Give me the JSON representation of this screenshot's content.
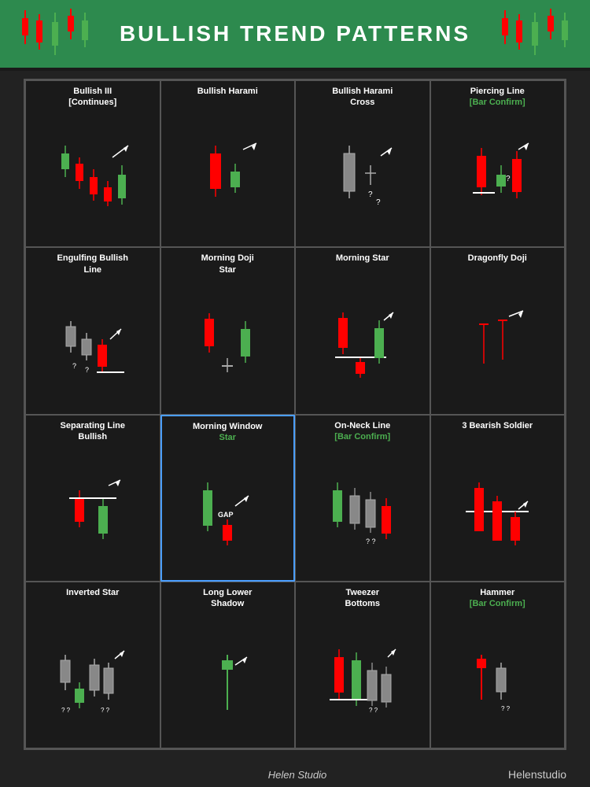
{
  "header": {
    "title": "BULLISH TREND PATTERNS"
  },
  "cells": [
    {
      "id": "bullish-3",
      "title": "Bullish III",
      "subtitle": "[Continues]",
      "subtitle_color": "white"
    },
    {
      "id": "bullish-harami",
      "title": "Bullish Harami",
      "subtitle": "",
      "subtitle_color": "white"
    },
    {
      "id": "bullish-harami-cross",
      "title": "Bullish Harami",
      "subtitle": "Cross",
      "subtitle_color": "white"
    },
    {
      "id": "piercing-line",
      "title": "Piercing Line",
      "subtitle": "[Bar Confirm]",
      "subtitle_color": "green"
    },
    {
      "id": "engulfing-bullish",
      "title": "Engulfing Bullish",
      "subtitle": "Line",
      "subtitle_color": "white"
    },
    {
      "id": "morning-doji-star",
      "title": "Morning Doji",
      "subtitle": "Star",
      "subtitle_color": "white"
    },
    {
      "id": "morning-star",
      "title": "Morning Star",
      "subtitle": "",
      "subtitle_color": "white"
    },
    {
      "id": "dragonfly-doji",
      "title": "Dragonfly Doji",
      "subtitle": "",
      "subtitle_color": "white"
    },
    {
      "id": "separating-line",
      "title": "Separating Line",
      "subtitle": "Bullish",
      "subtitle_color": "white"
    },
    {
      "id": "morning-window-star",
      "title": "Morning Window",
      "subtitle": "Star",
      "subtitle_color": "green",
      "highlight": true
    },
    {
      "id": "on-neck",
      "title": "On-Neck Line",
      "subtitle": "[Bar Confirm]",
      "subtitle_color": "green"
    },
    {
      "id": "3-bearish-soldier",
      "title": "3 Bearish Soldier",
      "subtitle": "",
      "subtitle_color": "white"
    },
    {
      "id": "inverted-star",
      "title": "Inverted Star",
      "subtitle": "",
      "subtitle_color": "white"
    },
    {
      "id": "long-lower-shadow",
      "title": "Long Lower",
      "subtitle": "Shadow",
      "subtitle_color": "white"
    },
    {
      "id": "tweezer-bottoms",
      "title": "Tweezer",
      "subtitle": "Bottoms",
      "subtitle_color": "white"
    },
    {
      "id": "hammer",
      "title": "Hammer",
      "subtitle": "[Bar Confirm]",
      "subtitle_color": "green"
    }
  ],
  "footer": {
    "logo_text": "Helen Studio",
    "brand_text": "Helenstudio"
  }
}
